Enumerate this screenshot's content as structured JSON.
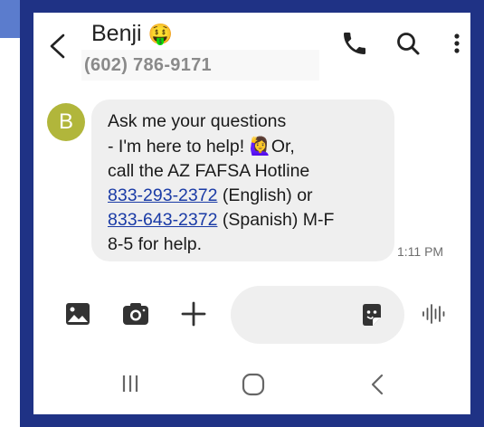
{
  "header": {
    "contact_name": "Benji",
    "contact_emoji": "🤑",
    "phone_number": "(602) 786-9171",
    "icons": [
      "back-arrow-icon",
      "phone-call-icon",
      "search-icon",
      "more-vert-icon"
    ]
  },
  "message": {
    "avatar_initial": "B",
    "avatar_color": "#b1b63b",
    "line1": "Ask me your questions",
    "line2_text": "- I'm here to help! ",
    "line2_emoji": "🙋‍♀️",
    "line2_tail": "Or,",
    "line3": "call the AZ FAFSA Hotline",
    "link1": "833-293-2372",
    "line4_tail": " (English) or",
    "link2": "833-643-2372",
    "line5_tail": " (Spanish) M-F",
    "line6": "8-5 for help.",
    "timestamp": "1:11 PM",
    "link_color": "#1a3ba6"
  },
  "composer": {
    "icons": [
      "gallery-icon",
      "camera-icon",
      "plus-icon",
      "sticker-icon",
      "voice-input-icon"
    ]
  },
  "navbar": {
    "icons": [
      "recent-apps-icon",
      "home-icon",
      "back-icon"
    ]
  },
  "colors": {
    "frame": "#1f3285",
    "accent": "#5b7ccd",
    "bubble": "#efefef"
  }
}
